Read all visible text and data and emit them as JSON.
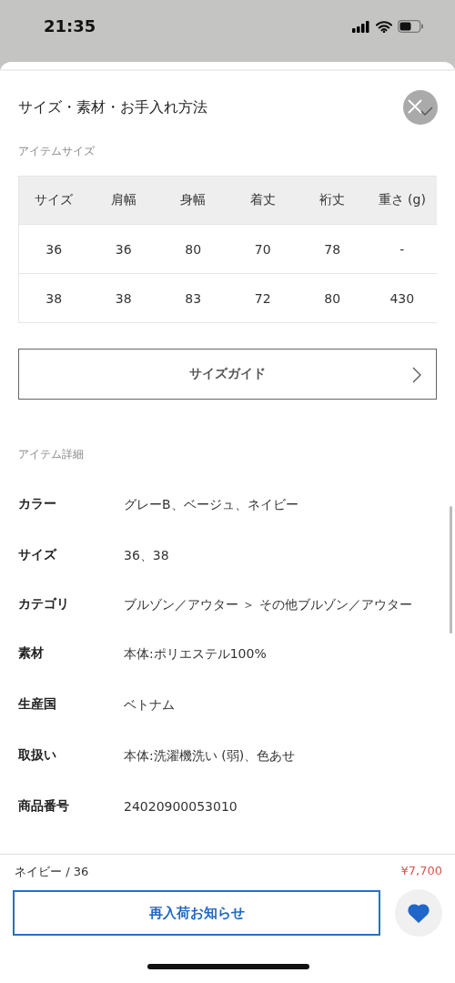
{
  "status_bar": {
    "time": "21:35"
  },
  "sheet": {
    "title": "サイズ・素材・お手入れ方法"
  },
  "size_section": {
    "heading": "アイテムサイズ",
    "table": {
      "columns": [
        "サイズ",
        "肩幅",
        "身幅",
        "着丈",
        "裄丈",
        "重さ (g)"
      ],
      "rows": [
        [
          "36",
          "36",
          "80",
          "70",
          "78",
          "-"
        ],
        [
          "38",
          "38",
          "83",
          "72",
          "80",
          "430"
        ]
      ]
    },
    "guide_button": "サイズガイド"
  },
  "detail_section": {
    "heading": "アイテム詳細",
    "rows": [
      {
        "label": "カラー",
        "value": "グレーB、ベージュ、ネイビー"
      },
      {
        "label": "サイズ",
        "value": "36、38"
      },
      {
        "label": "カテゴリ",
        "value": "ブルゾン／アウター ＞ その他ブルゾン／アウター"
      },
      {
        "label": "素材",
        "value": "本体:ポリエステル100%"
      },
      {
        "label": "生産国",
        "value": "ベトナム"
      },
      {
        "label": "取扱い",
        "value": "本体:洗濯機洗い (弱)、色あせ"
      },
      {
        "label": "商品番号",
        "value": "24020900053010"
      }
    ]
  },
  "footer": {
    "variant": "ネイビー / 36",
    "price": "¥7,700",
    "restock_button": "再入荷お知らせ",
    "favorite": true
  }
}
